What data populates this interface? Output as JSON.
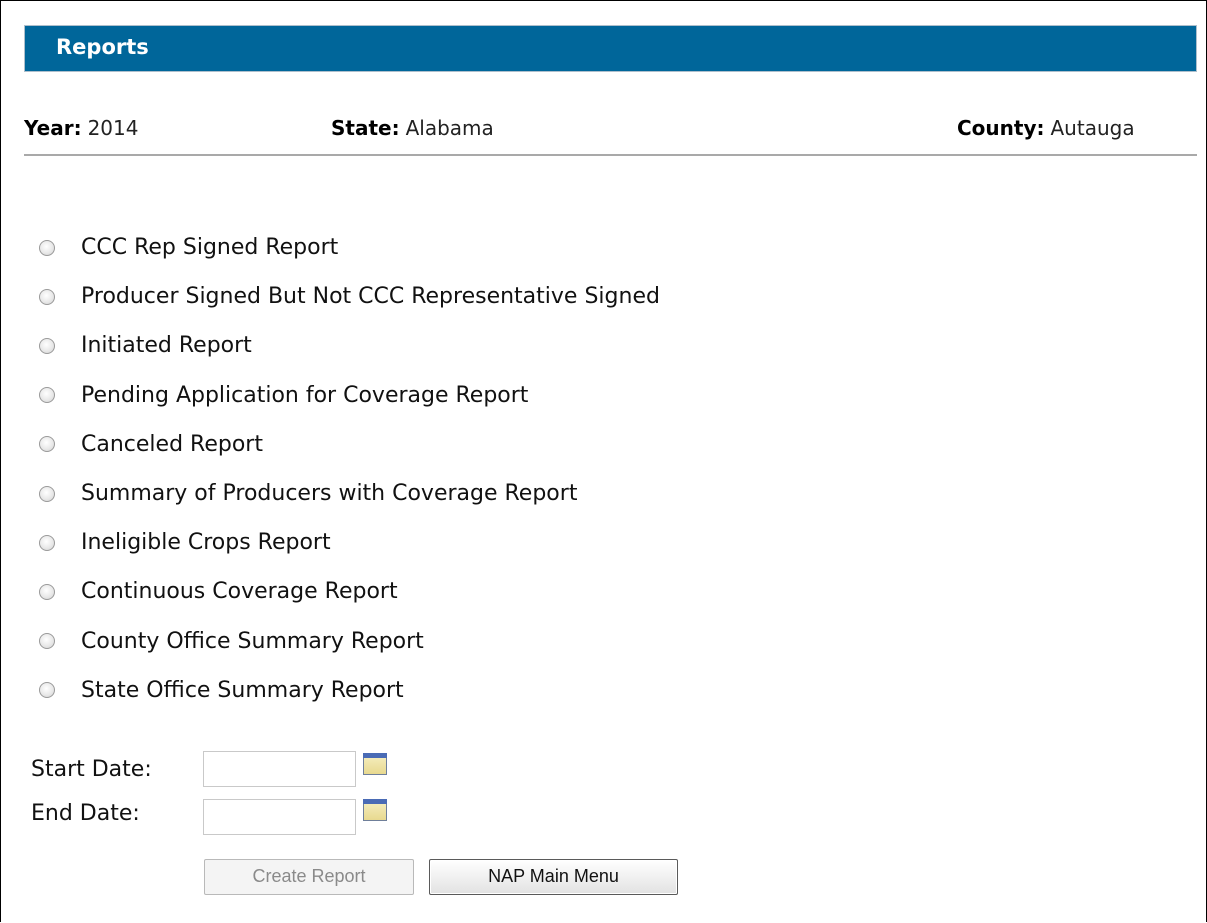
{
  "header": {
    "title": "Reports"
  },
  "info": {
    "year_label": "Year:",
    "year_value": "2014",
    "state_label": "State:",
    "state_value": "Alabama",
    "county_label": "County:",
    "county_value": "Autauga"
  },
  "report_options": [
    "CCC Rep Signed Report",
    "Producer Signed But Not CCC Representative Signed",
    "Initiated Report",
    "Pending Application for Coverage Report",
    "Canceled Report",
    "Summary of Producers with Coverage Report",
    "Ineligible Crops Report",
    "Continuous Coverage Report",
    "County Office Summary Report",
    "State Office Summary Report"
  ],
  "dates": {
    "start_label": "Start Date:",
    "start_value": "",
    "end_label": "End Date:",
    "end_value": ""
  },
  "buttons": {
    "create_report": "Create Report",
    "nap_main_menu": "NAP Main Menu"
  },
  "icons": {
    "calendar": "calendar-icon",
    "radio": "radio-unselected"
  },
  "colors": {
    "header_bg": "#00669a",
    "header_text": "#ffffff"
  }
}
